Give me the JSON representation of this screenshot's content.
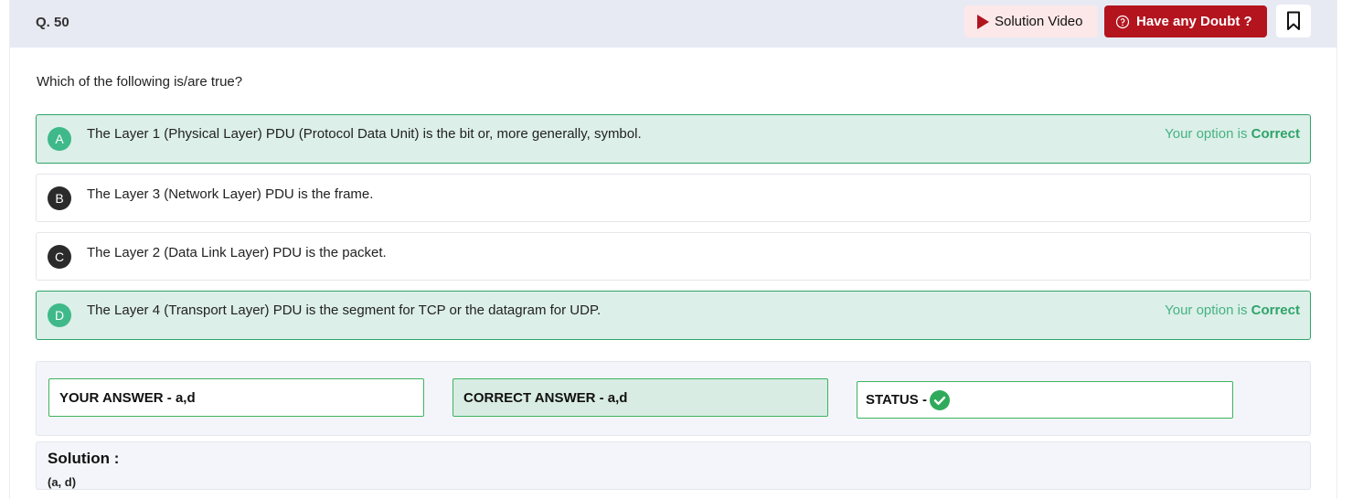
{
  "header": {
    "question_number": "Q. 50",
    "solution_video_label": "Solution Video",
    "doubt_label": "Have any Doubt ?"
  },
  "question": {
    "text": "Which of the following is/are true?"
  },
  "options": [
    {
      "letter": "A",
      "text": "The Layer 1 (Physical Layer) PDU (Protocol Data Unit) is the bit or, more generally, symbol.",
      "status_prefix": "Your option is",
      "status_word": "Correct",
      "selected": true
    },
    {
      "letter": "B",
      "text": "The Layer 3 (Network Layer) PDU is the frame.",
      "selected": false
    },
    {
      "letter": "C",
      "text": "The Layer 2 (Data Link Layer) PDU is the packet.",
      "selected": false
    },
    {
      "letter": "D",
      "text": "The Layer 4 (Transport Layer) PDU is the segment for TCP or the datagram for UDP.",
      "status_prefix": "Your option is",
      "status_word": "Correct",
      "selected": true
    }
  ],
  "answer_summary": {
    "your_answer": "YOUR ANSWER - a,d",
    "correct_answer": "CORRECT ANSWER - a,d",
    "status_label": "STATUS -"
  },
  "solution": {
    "title": "Solution :",
    "text": "(a, d)"
  },
  "colors": {
    "brand_red": "#b3141e",
    "correct_green": "#3fb98a",
    "correct_bg": "#dcefe8",
    "header_bg": "#e8eaf3"
  },
  "icons": {
    "play": "play-icon",
    "doubt": "chat-question-icon",
    "bookmark": "bookmark-icon",
    "status": "check-circle-icon"
  }
}
